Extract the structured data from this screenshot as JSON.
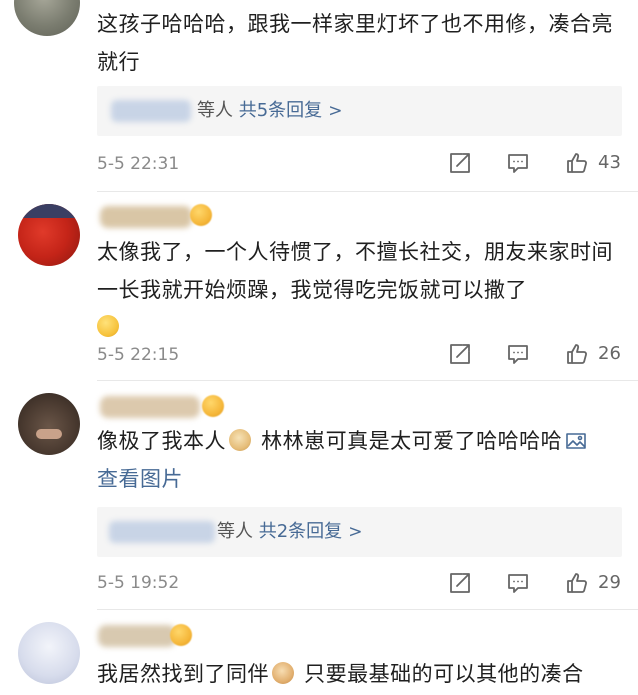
{
  "comments": [
    {
      "text": "这孩子哈哈哈，跟我一样家里灯坏了也不用修，凑合亮就行",
      "replies": {
        "suffix": "等人 ",
        "count": "共5条回复",
        "arrow": ">"
      },
      "timestamp": "5-5 22:31",
      "likes": "43"
    },
    {
      "text": "太像我了，一个人待惯了，不擅长社交，朋友来家时间一长我就开始烦躁，我觉得吃完饭就可以撒了",
      "timestamp": "5-5 22:15",
      "likes": "26"
    },
    {
      "text_before": "像极了我本人",
      "text_after": " 林林崽可真是太可爱了哈哈哈哈",
      "link": "查看图片",
      "replies": {
        "suffix": "等人 ",
        "count": "共2条回复",
        "arrow": ">"
      },
      "timestamp": "5-5 19:52",
      "likes": "29"
    },
    {
      "text_before": "我居然找到了同伴",
      "text_after": " 只要最基础的可以其他的凑合"
    }
  ],
  "icons": {
    "share": "share-icon",
    "comment": "comment-icon",
    "like": "thumbs-up-icon",
    "emoji_laugh": "laughing-emoji-icon",
    "emoji_doge": "doge-emoji-icon",
    "emoji_cat": "cat-emoji-icon",
    "image": "image-icon"
  },
  "colors": {
    "link": "#476a95",
    "meta": "#8a8a8a",
    "reply_bg": "#f5f5f5"
  }
}
